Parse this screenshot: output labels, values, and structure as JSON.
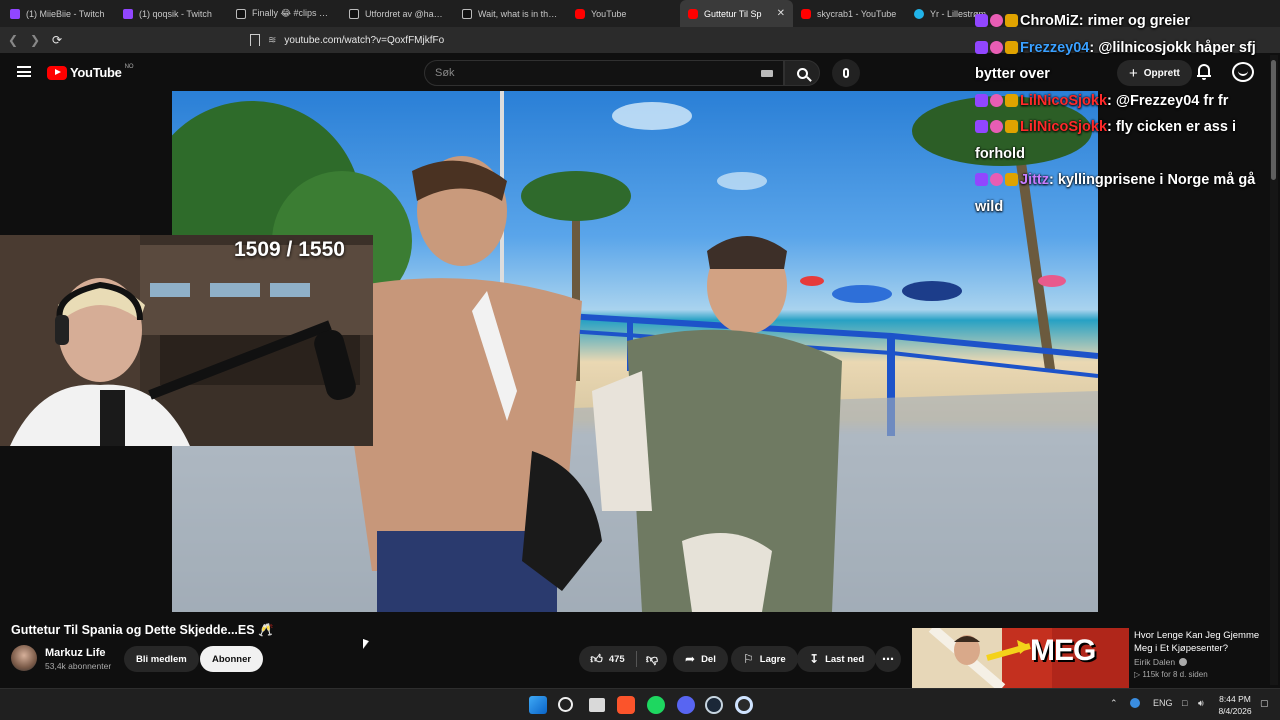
{
  "browser": {
    "tabs": [
      {
        "label": "(1) MiieBiie - Twitch",
        "icon": "twitch-icon",
        "active": false
      },
      {
        "label": "(1) qoqsik - Twitch",
        "icon": "twitch-icon",
        "active": false
      },
      {
        "label": "Finally 😂 #clips #twi",
        "icon": "tiktok-icon",
        "active": false
      },
      {
        "label": "Utfordret av @handen",
        "icon": "tiktok-icon",
        "active": false
      },
      {
        "label": "Wait, what is in that w",
        "icon": "tiktok-icon",
        "active": false
      },
      {
        "label": "YouTube",
        "icon": "youtube-icon",
        "active": false
      },
      {
        "label": "Guttetur Til Sp",
        "icon": "youtube-icon",
        "active": true
      },
      {
        "label": "skycrab1 - YouTube",
        "icon": "youtube-icon",
        "active": false
      },
      {
        "label": "Yr - Lillestrøm",
        "icon": "yr-icon",
        "active": false
      }
    ],
    "url": "youtube.com/watch?v=QoxfFMjkfFo"
  },
  "youtube": {
    "logo_text": "YouTube",
    "region": "NO",
    "search_placeholder": "Søk",
    "create_label": "Opprett"
  },
  "stream_overlay": {
    "sub_counter": "1509 / 1550",
    "chat": [
      {
        "user": "ChroMiZ",
        "user_color": "#ffffff",
        "message": "rimer og greier"
      },
      {
        "user": "Frezzey04",
        "user_color": "#3aa0ff",
        "message": "@lilnicosjokk håper sfj bytter over"
      },
      {
        "user": "LilNicoSjokk",
        "user_color": "#ff2a2a",
        "message": "@Frezzey04 fr fr"
      },
      {
        "user": "LilNicoSjokk",
        "user_color": "#ff2a2a",
        "message": "fly cicken er ass i forhold"
      },
      {
        "user": "Jittz",
        "user_color": "#c77dff",
        "message": "kyllingprisene i Norge må gå wild"
      }
    ]
  },
  "video": {
    "title": "Guttetur Til Spania og Dette Skjedde...ES 🥂",
    "channel": "Markuz Life",
    "subscribers": "53,4k abonnenter",
    "member_label": "Bli medlem",
    "subscribe_label": "Abonner",
    "likes": "475",
    "share_label": "Del",
    "save_label": "Lagre",
    "download_label": "Last ned"
  },
  "recommended": {
    "title": "Hvor Lenge Kan Jeg Gjemme Meg i Et Kjøpesenter?",
    "channel": "Eirik Dalen",
    "views": "115k",
    "age": "for 8 d. siden",
    "thumb_text": "MEG"
  },
  "taskbar": {
    "language": "ENG",
    "time": "8:44 PM",
    "date": "8/4/2026"
  }
}
